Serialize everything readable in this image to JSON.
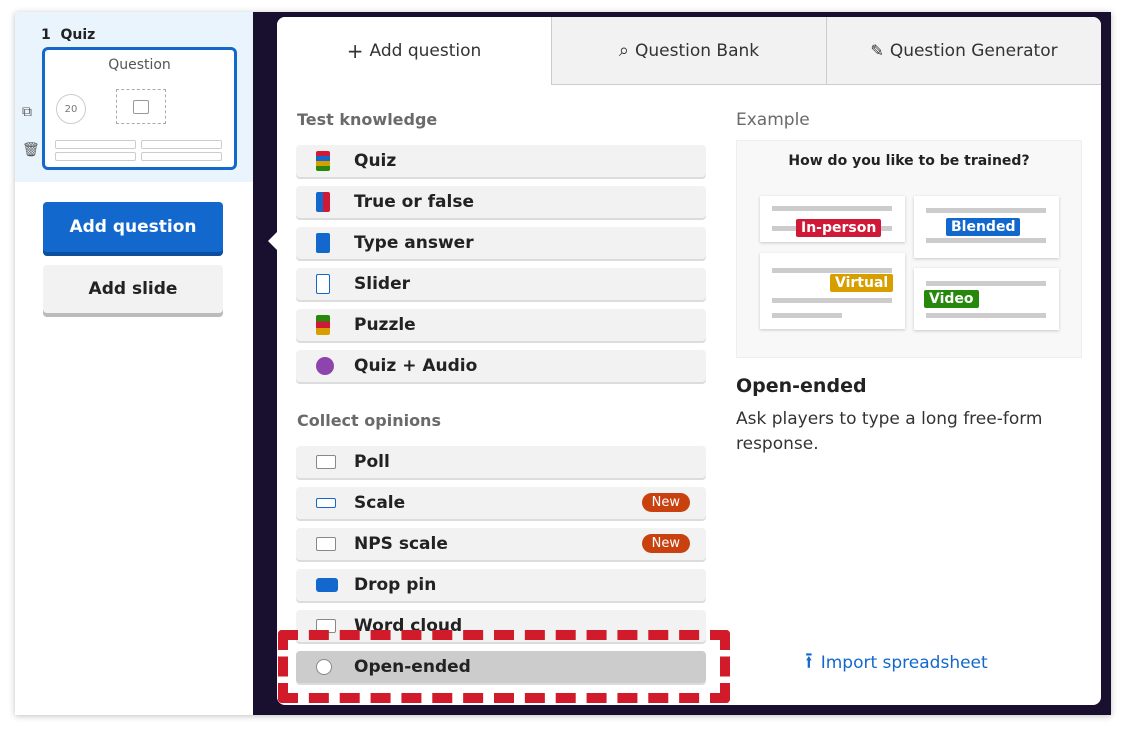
{
  "sidebar": {
    "slide_number": "1",
    "slide_label": "Quiz",
    "thumb_title": "Question",
    "thumb_timer": "20",
    "add_question_label": "Add question",
    "add_slide_label": "Add slide"
  },
  "tabs": [
    {
      "label": "Add question",
      "icon": "plus-icon"
    },
    {
      "label": "Question Bank",
      "icon": "search-icon"
    },
    {
      "label": "Question Generator",
      "icon": "magic-wand-icon"
    }
  ],
  "sections": {
    "test_knowledge": "Test knowledge",
    "collect_opinions": "Collect opinions"
  },
  "test_items": [
    {
      "label": "Quiz"
    },
    {
      "label": "True or false"
    },
    {
      "label": "Type answer"
    },
    {
      "label": "Slider"
    },
    {
      "label": "Puzzle"
    },
    {
      "label": "Quiz + Audio"
    }
  ],
  "opinion_items": [
    {
      "label": "Poll"
    },
    {
      "label": "Scale",
      "badge": "New"
    },
    {
      "label": "NPS scale",
      "badge": "New"
    },
    {
      "label": "Drop pin"
    },
    {
      "label": "Word cloud"
    },
    {
      "label": "Open-ended"
    }
  ],
  "example": {
    "title": "Example",
    "question": "How do you like to be trained?",
    "tags": [
      "In-person",
      "Blended",
      "Virtual",
      "Video"
    ],
    "type_title": "Open-ended",
    "type_desc": "Ask players to type a long free-form response."
  },
  "import_label": "Import spreadsheet",
  "colors": {
    "primary": "#1368ce",
    "badge": "#c8410f",
    "tag_red": "#d01937",
    "tag_blue": "#1368ce",
    "tag_yellow": "#d89e00",
    "tag_green": "#26890c",
    "highlight": "#d11a2a"
  }
}
